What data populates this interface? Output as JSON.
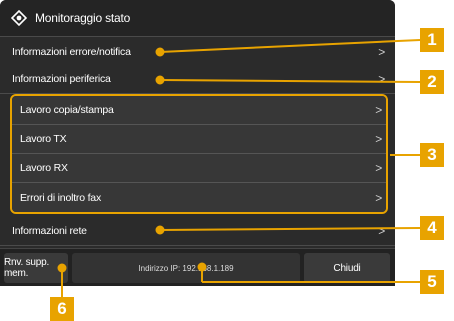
{
  "title": "Monitoraggio stato",
  "rows": [
    {
      "label": "Informazioni errore/notifica",
      "chevron": ">"
    },
    {
      "label": "Informazioni periferica",
      "chevron": ">"
    }
  ],
  "group_rows": [
    {
      "label": "Lavoro copia/stampa",
      "chevron": ">"
    },
    {
      "label": "Lavoro TX",
      "chevron": ">"
    },
    {
      "label": "Lavoro RX",
      "chevron": ">"
    },
    {
      "label": "Errori di inoltro fax",
      "chevron": ">"
    }
  ],
  "network_row": {
    "label": "Informazioni rete",
    "chevron": ">"
  },
  "bottom": {
    "memory_button": "Rnv. supp. mem.",
    "ip_text": "Indirizzo IP: 192.168.1.189",
    "close_button": "Chiudi"
  },
  "callouts": [
    "1",
    "2",
    "3",
    "4",
    "5",
    "6"
  ],
  "colors": {
    "accent": "#e8a300",
    "background": "#2b2b2b",
    "text": "#ffffff"
  },
  "icons": {
    "title": "status-monitor-icon",
    "row_arrow": "chevron-right-icon"
  }
}
